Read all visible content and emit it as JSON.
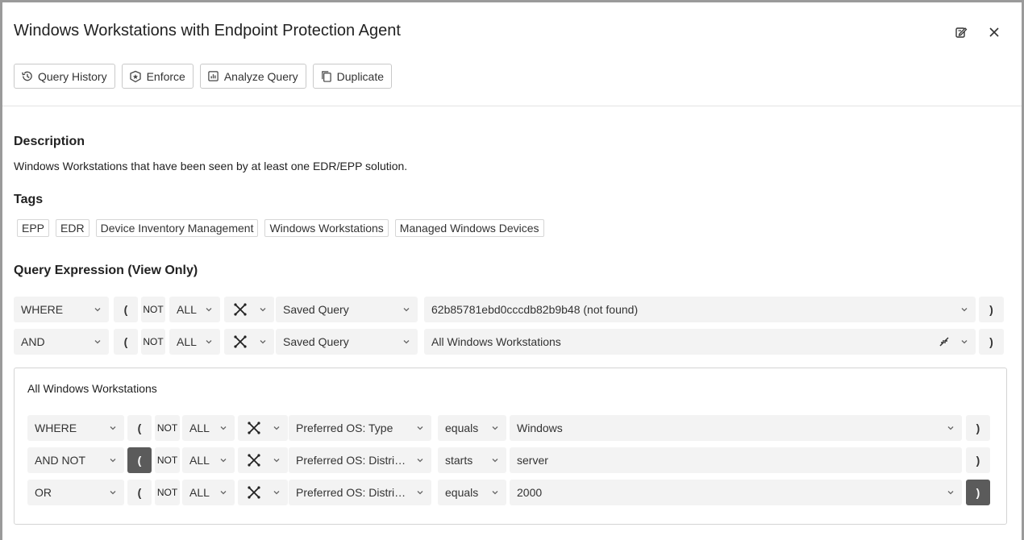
{
  "header": {
    "title": "Windows Workstations with Endpoint Protection Agent",
    "edit_icon": "edit-note-icon",
    "close_icon": "close-icon"
  },
  "toolbar": {
    "query_history": "Query History",
    "enforce": "Enforce",
    "analyze_query": "Analyze Query",
    "duplicate": "Duplicate"
  },
  "description": {
    "heading": "Description",
    "text": "Windows Workstations that have been seen by at least one EDR/EPP solution."
  },
  "tags": {
    "heading": "Tags",
    "items": [
      "EPP",
      "EDR",
      "Device Inventory Management",
      "Windows Workstations",
      "Managed Windows Devices"
    ]
  },
  "query": {
    "heading": "Query Expression (View Only)",
    "rows": [
      {
        "logic": "WHERE",
        "open": "(",
        "not": "NOT",
        "scope": "ALL",
        "field": "Saved Query",
        "value": "62b85781ebd0cccdb82b9b48 (not found)",
        "close": ")"
      },
      {
        "logic": "AND",
        "open": "(",
        "not": "NOT",
        "scope": "ALL",
        "field": "Saved Query",
        "value": "All Windows Workstations",
        "close": ")"
      }
    ]
  },
  "subquery": {
    "title": "All Windows Workstations",
    "rows": [
      {
        "logic": "WHERE",
        "open": "(",
        "not": "NOT",
        "scope": "ALL",
        "field": "Preferred OS: Type",
        "operator": "equals",
        "value": "Windows",
        "close": ")"
      },
      {
        "logic": "AND NOT",
        "open": "(",
        "not": "NOT",
        "scope": "ALL",
        "field": "Preferred OS: Distrib...",
        "operator": "starts",
        "value": "server",
        "close": ")"
      },
      {
        "logic": "OR",
        "open": "(",
        "not": "NOT",
        "scope": "ALL",
        "field": "Preferred OS: Distrib...",
        "operator": "equals",
        "value": "2000",
        "close": ")"
      }
    ]
  },
  "colors": {
    "field_bg": "#f3f3f3",
    "dark_paren": "#5b5b5b"
  }
}
